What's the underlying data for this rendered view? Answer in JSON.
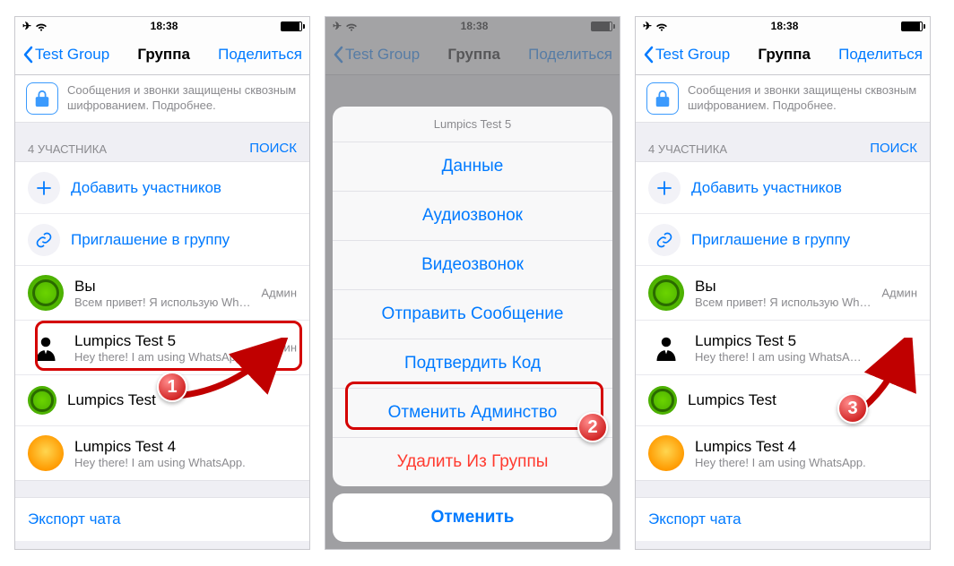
{
  "status": {
    "time": "18:38"
  },
  "nav": {
    "back": "Test Group",
    "title": "Группа",
    "share": "Поделиться"
  },
  "encryption": "Сообщения и звонки защищены сквозным шифрованием. Подробнее.",
  "participants_header": "4 УЧАСТНИКА",
  "search": "ПОИСК",
  "add": "Добавить участников",
  "invite": "Приглашение в группу",
  "members": {
    "you": {
      "name": "Вы",
      "status": "Всем привет! Я использую Wh…",
      "badge": "Админ"
    },
    "m1": {
      "name": "Lumpics Test 5",
      "status": "Hey there! I am using WhatsApp.",
      "badge": "Админ"
    },
    "m1_noadmin": {
      "name": "Lumpics Test 5",
      "status": "Hey there! I am using WhatsA…"
    },
    "m2": {
      "name": "Lumpics Test"
    },
    "m3": {
      "name": "Lumpics Test 4",
      "status": "Hey there! I am using WhatsApp."
    }
  },
  "export": "Экспорт чата",
  "sheet": {
    "title": "Lumpics Test 5",
    "info": "Данные",
    "audio": "Аудиозвонок",
    "video": "Видеозвонок",
    "send": "Отправить Сообщение",
    "verify": "Подтвердить Код",
    "revoke": "Отменить Админство",
    "remove": "Удалить Из Группы",
    "cancel": "Отменить"
  },
  "steps": {
    "s1": "1",
    "s2": "2",
    "s3": "3"
  }
}
